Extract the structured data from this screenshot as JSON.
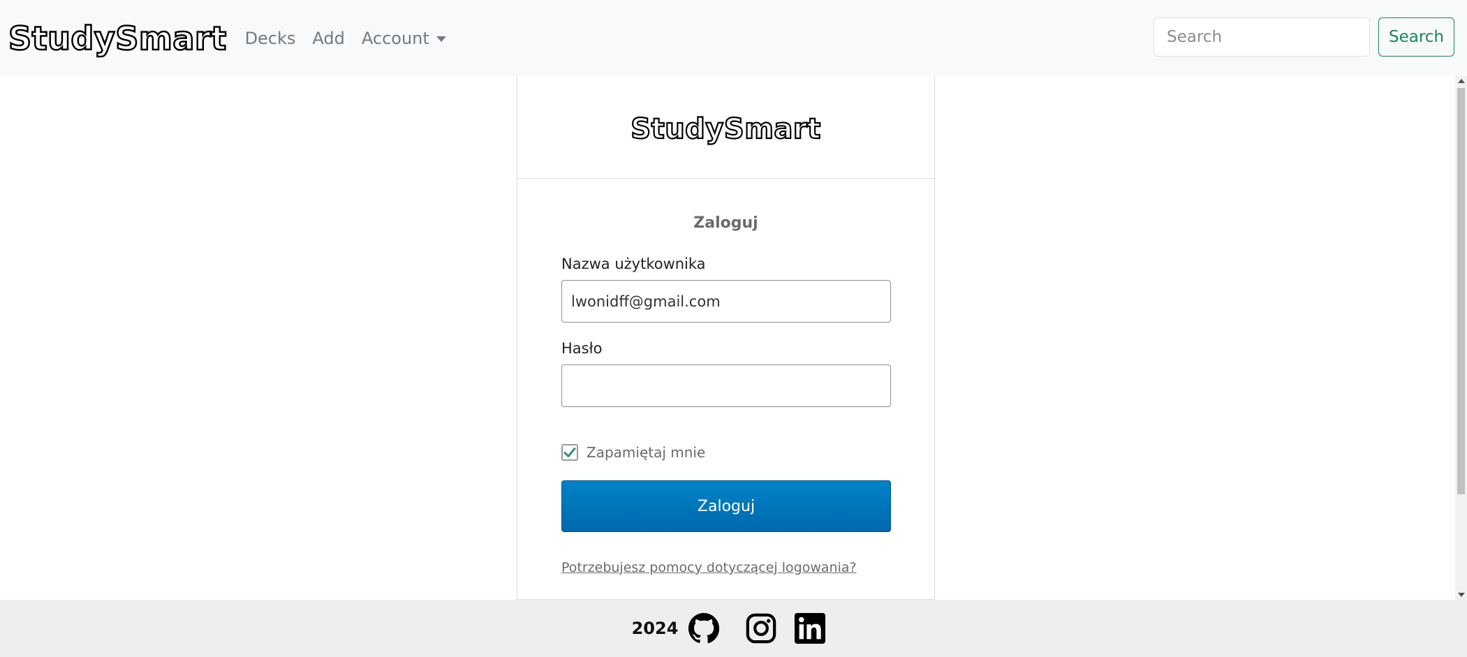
{
  "navbar": {
    "brand": "StudySmart",
    "links": [
      {
        "label": "Decks"
      },
      {
        "label": "Add"
      },
      {
        "label": "Account"
      }
    ],
    "search": {
      "placeholder": "Search",
      "button_label": "Search"
    }
  },
  "login_card": {
    "logo": "StudySmart",
    "title": "Zaloguj",
    "username": {
      "label": "Nazwa użytkownika",
      "value": "lwonidff@gmail.com"
    },
    "password": {
      "label": "Hasło",
      "value": ""
    },
    "remember_me": {
      "label": "Zapamiętaj mnie",
      "checked": true
    },
    "submit_label": "Zaloguj",
    "help_link": "Potrzebujesz pomocy dotyczącej logowania?"
  },
  "footer": {
    "year": "2024",
    "icons": [
      "github-icon",
      "instagram-icon",
      "linkedin-icon"
    ]
  },
  "colors": {
    "navbar_bg": "#f8f9fa",
    "search_button": "#198754",
    "submit_button": "#0075bb",
    "checkbox_check": "#3a8f6e",
    "footer_bg": "#eeeeee"
  }
}
